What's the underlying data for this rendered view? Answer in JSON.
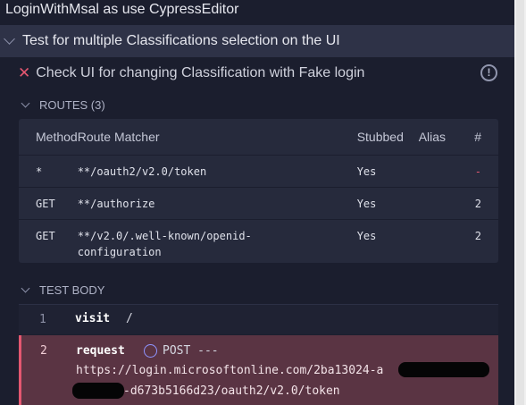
{
  "window": {
    "title": "LoginWithMsal as use CypressEditor"
  },
  "suite": {
    "title": "Test for multiple Classifications selection on the UI"
  },
  "test": {
    "title": "Check UI for changing Classification with Fake login",
    "status_icon": "close-icon",
    "alert_icon": "!"
  },
  "routes": {
    "header": "ROUTES (3)",
    "columns": [
      "Method",
      "Route Matcher",
      "Stubbed",
      "Alias",
      "#"
    ],
    "rows": [
      {
        "method": "*",
        "matcher": "**/oauth2/v2.0/token",
        "stubbed": "Yes",
        "alias": "",
        "count": "-"
      },
      {
        "method": "GET",
        "matcher": "**/authorize",
        "stubbed": "Yes",
        "alias": "",
        "count": "2"
      },
      {
        "method": "GET",
        "matcher_line1": "**/v2.0/.well-known/openid-",
        "matcher_line2": "configuration",
        "stubbed": "Yes",
        "alias": "",
        "count": "2"
      }
    ]
  },
  "test_body": {
    "header": "TEST BODY",
    "commands": [
      {
        "number": "1",
        "name": "visit",
        "message": "/"
      },
      {
        "number": "2",
        "name": "request",
        "message": "POST ---",
        "url_line1": "https://login.microsoftonline.com/2ba13024-a",
        "url_line2": "-d673b5166d23/oauth2/v2.0/token"
      }
    ]
  },
  "colors": {
    "background": "#1b1e2e",
    "suite_bg": "#2e3247",
    "panel_bg": "#262a3c",
    "failed_bg": "#5a3443",
    "failed_accent": "#e45770"
  }
}
